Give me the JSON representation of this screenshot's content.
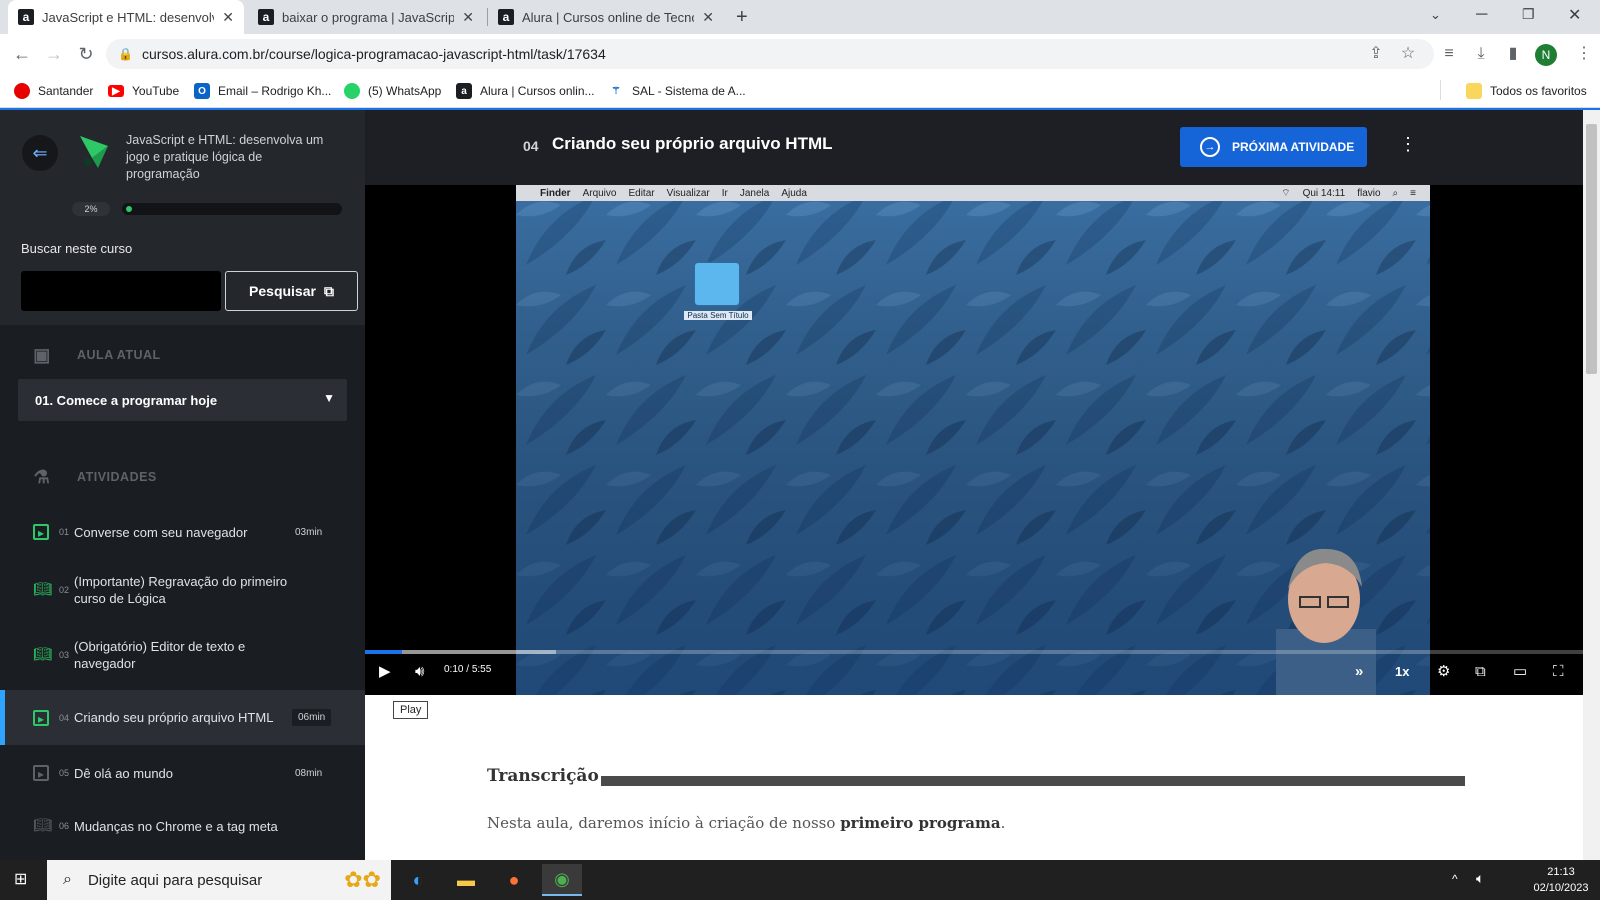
{
  "browser": {
    "tabs": [
      {
        "title": "JavaScript e HTML: desenvolva u",
        "favicon": "a",
        "active": true
      },
      {
        "title": "baixar o programa | JavaScript e",
        "favicon": "a",
        "active": false
      },
      {
        "title": "Alura | Cursos online de Tecnolo",
        "favicon": "a",
        "active": false
      }
    ],
    "url": "cursos.alura.com.br/course/logica-programacao-javascript-html/task/17634",
    "profile_initial": "N",
    "bookmarks": [
      "Santander",
      "YouTube",
      "Email – Rodrigo Kh...",
      "(5) WhatsApp",
      "Alura | Cursos onlin...",
      "SAL - Sistema de A..."
    ],
    "all_bookmarks": "Todos os favoritos"
  },
  "sidebar": {
    "course_title": "JavaScript e HTML: desenvolva um jogo e pratique lógica de programação",
    "progress_label": "2%",
    "progress": 0.02,
    "search_label": "Buscar neste curso",
    "search_button": "Pesquisar",
    "aula_heading": "AULA ATUAL",
    "aula_selected": "01. Comece a programar hoje",
    "activities_heading": "ATIVIDADES",
    "activities": [
      {
        "num": "01",
        "label": "Converse com seu navegador",
        "duration": "03min"
      },
      {
        "num": "02",
        "label": "(Importante) Regravação do primeiro curso de Lógica",
        "duration": ""
      },
      {
        "num": "03",
        "label": "(Obrigatório) Editor de texto e navegador",
        "duration": ""
      },
      {
        "num": "04",
        "label": "Criando seu próprio arquivo HTML",
        "duration": "06min"
      },
      {
        "num": "05",
        "label": "Dê olá ao mundo",
        "duration": "08min"
      },
      {
        "num": "06",
        "label": "Mudanças no Chrome e a tag meta",
        "duration": ""
      }
    ]
  },
  "lesson": {
    "number": "04",
    "title": "Criando seu próprio arquivo HTML",
    "next_button": "PRÓXIMA ATIVIDADE"
  },
  "video": {
    "mac_menu": [
      "Finder",
      "Arquivo",
      "Editar",
      "Visualizar",
      "Ir",
      "Janela",
      "Ajuda"
    ],
    "mac_status": "Qui 14:11",
    "mac_user": "flavio",
    "folder_label": "Pasta Sem Título",
    "current_time": "0:10",
    "separator": "/",
    "duration": "5:55",
    "played_fraction": 0.03,
    "buffered_fraction": 0.157,
    "speed": "1x",
    "tooltip": "Play"
  },
  "transcript": {
    "title": "Transcrição",
    "text_before": "Nesta aula, daremos início à criação de nosso ",
    "text_bold": "primeiro programa",
    "text_after": "."
  },
  "taskbar": {
    "search_placeholder": "Digite aqui para pesquisar",
    "time": "21:13",
    "date": "02/10/2023"
  }
}
